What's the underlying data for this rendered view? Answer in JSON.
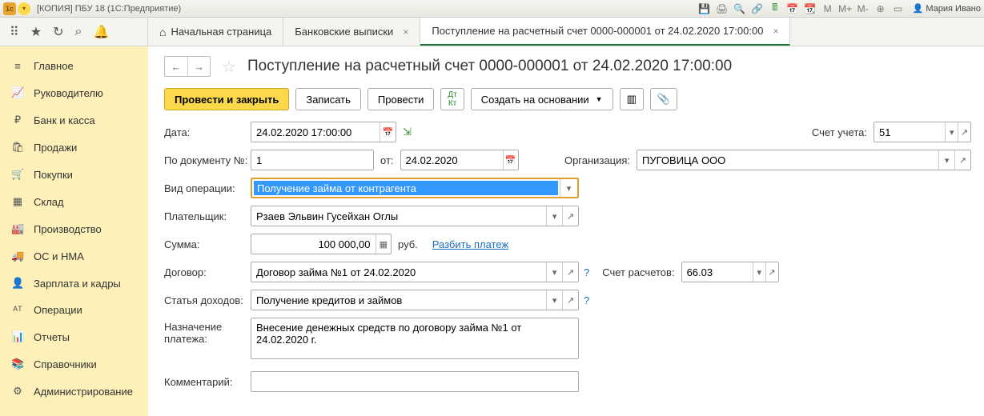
{
  "titlebar": {
    "title": "[КОПИЯ] ПБУ 18  (1С:Предприятие)",
    "user": "Мария Ивано"
  },
  "tabs": [
    {
      "label": "Начальная страница",
      "home": true
    },
    {
      "label": "Банковские выписки",
      "closable": true
    },
    {
      "label": "Поступление на расчетный счет 0000-000001 от 24.02.2020 17:00:00",
      "closable": true,
      "active": true
    }
  ],
  "sidebar": [
    {
      "icon": "≡",
      "label": "Главное"
    },
    {
      "icon": "📈",
      "label": "Руководителю"
    },
    {
      "icon": "₽",
      "label": "Банк и касса"
    },
    {
      "icon": "🛍",
      "label": "Продажи"
    },
    {
      "icon": "🛒",
      "label": "Покупки"
    },
    {
      "icon": "▦",
      "label": "Склад"
    },
    {
      "icon": "🏭",
      "label": "Производство"
    },
    {
      "icon": "🚚",
      "label": "ОС и НМА"
    },
    {
      "icon": "👤",
      "label": "Зарплата и кадры"
    },
    {
      "icon": "ᴬᵀ",
      "label": "Операции"
    },
    {
      "icon": "📊",
      "label": "Отчеты"
    },
    {
      "icon": "📚",
      "label": "Справочники"
    },
    {
      "icon": "⚙",
      "label": "Администрирование"
    }
  ],
  "page": {
    "title": "Поступление на расчетный счет 0000-000001 от 24.02.2020 17:00:00"
  },
  "toolbar": {
    "post_close": "Провести и закрыть",
    "save": "Записать",
    "post": "Провести",
    "create_based": "Создать на основании"
  },
  "labels": {
    "date": "Дата:",
    "doc_no": "По документу №:",
    "from": "от:",
    "op_type": "Вид операции:",
    "payer": "Плательщик:",
    "sum": "Сумма:",
    "rub": "руб.",
    "split": "Разбить платеж",
    "contract": "Договор:",
    "income_art": "Статья доходов:",
    "purpose": "Назначение платежа:",
    "comment": "Комментарий:",
    "account": "Счет учета:",
    "org": "Организация:",
    "calc_account": "Счет расчетов:"
  },
  "values": {
    "date": "24.02.2020 17:00:00",
    "doc_no": "1",
    "doc_date": "24.02.2020",
    "op_type": "Получение займа от контрагента",
    "payer": "Рзаев Эльвин Гусейхан Оглы",
    "sum": "100 000,00",
    "contract": "Договор займа №1 от 24.02.2020",
    "income_art": "Получение кредитов и займов",
    "purpose": "Внесение денежных средств по договору займа №1 от 24.02.2020 г.",
    "comment": "",
    "account": "51",
    "org": "ПУГОВИЦА ООО",
    "calc_account": "66.03"
  }
}
